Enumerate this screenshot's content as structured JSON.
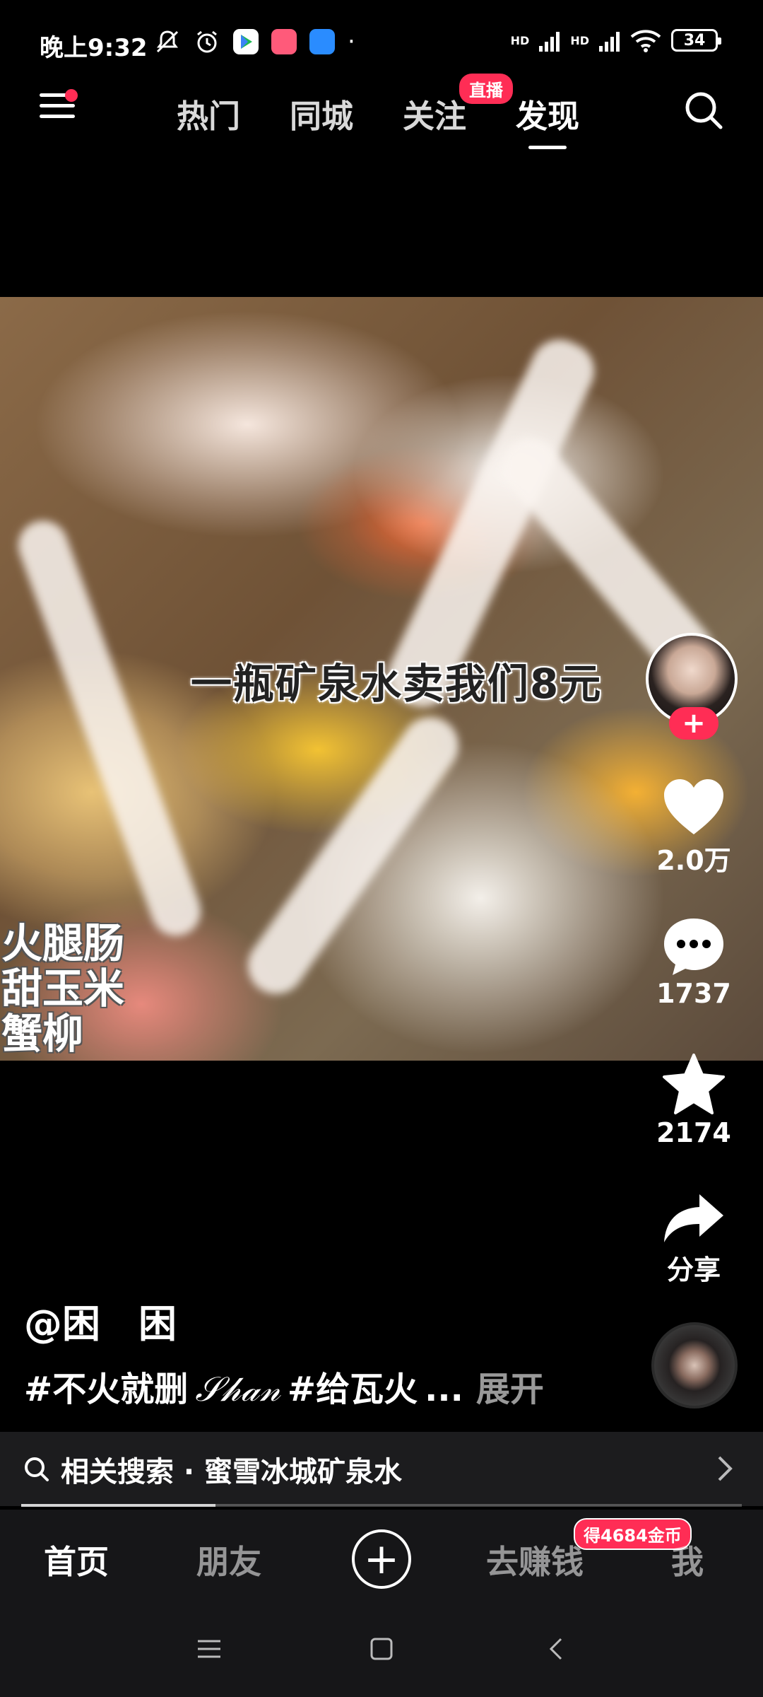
{
  "status_bar": {
    "time": "晚上9:32",
    "signal_label_1": "HD",
    "signal_label_2": "HD",
    "battery": "34",
    "extra_dot": "·"
  },
  "top_nav": {
    "tabs": [
      {
        "label": "热门"
      },
      {
        "label": "同城"
      },
      {
        "label": "关注"
      },
      {
        "label": "发现"
      }
    ],
    "active_tab": "发现",
    "live_badge": "直播"
  },
  "video": {
    "caption": "一瓶矿泉水卖我们8元",
    "ingredient_labels": [
      "火腿肠",
      "甜玉米",
      "蟹柳"
    ]
  },
  "right_rail": {
    "follow_label": "+",
    "likes": "2.0万",
    "comments": "1737",
    "favorites": "2174",
    "share_label": "分享"
  },
  "post": {
    "author": "@困　困",
    "hashtag_1": "#不火就删",
    "hashtag_script": "𝒮𝒽𝒶𝓃",
    "hashtag_2": "#给瓦火",
    "ellipsis": "...",
    "expand_label": "展开"
  },
  "related_search": {
    "text": "相关搜索 · 蜜雪冰城矿泉水"
  },
  "playback_progress": 0.27,
  "bottom_nav": {
    "home": "首页",
    "friends": "朋友",
    "create": "+",
    "earn": "去赚钱",
    "earn_badge": "得4684金币",
    "me": "我"
  },
  "colors": {
    "accent": "#ff2d55",
    "background": "#000000",
    "bar": "#161618"
  }
}
